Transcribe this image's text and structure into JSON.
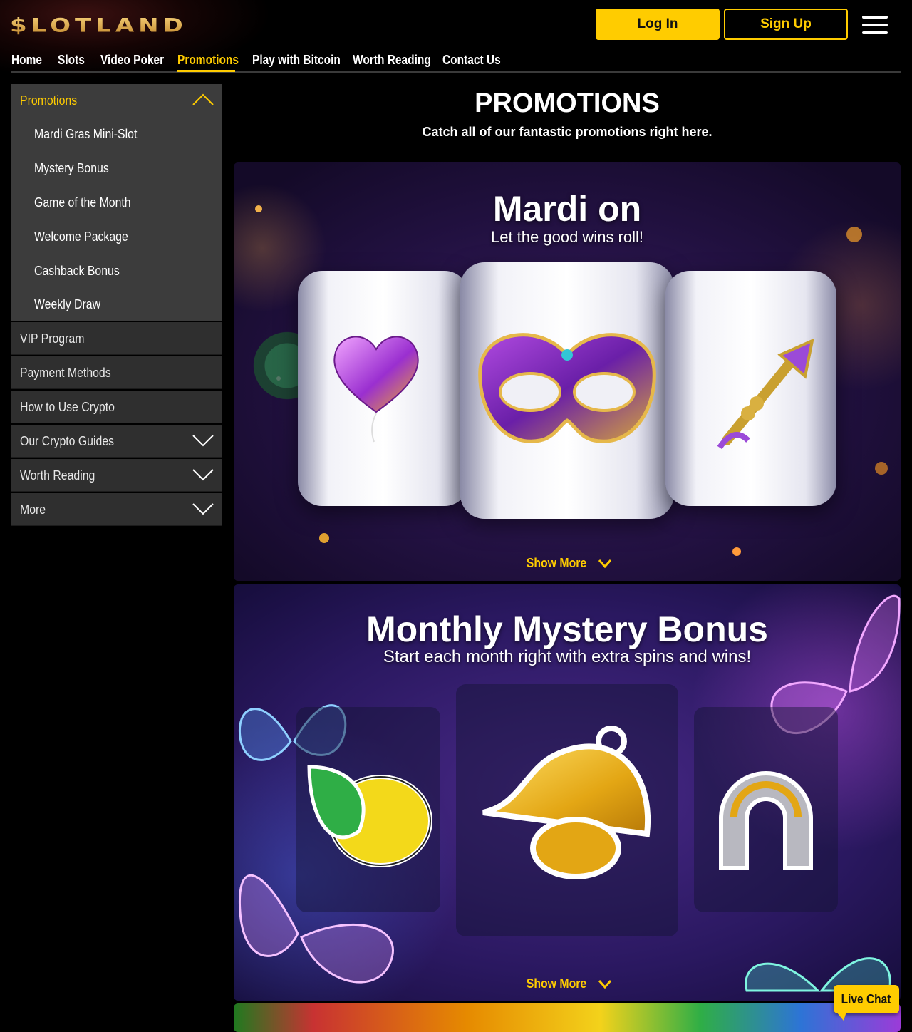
{
  "header": {
    "logo_text": "$LOTLAND",
    "login_label": "Log In",
    "signup_label": "Sign Up",
    "menu_icon": "hamburger-icon"
  },
  "nav": {
    "items": [
      "Home",
      "Slots",
      "Video Poker",
      "Promotions",
      "Play with Bitcoin",
      "Worth Reading",
      "Contact Us"
    ],
    "active": "Promotions"
  },
  "sidebar": {
    "group": {
      "label": "Promotions",
      "expanded": true,
      "items": [
        "Mardi Gras Mini-Slot",
        "Mystery Bonus",
        "Game of the Month",
        "Welcome Package",
        "Cashback Bonus",
        "Weekly Draw"
      ]
    },
    "items": [
      {
        "label": "VIP Program",
        "has_chevron": false
      },
      {
        "label": "Payment Methods",
        "has_chevron": false
      },
      {
        "label": "How to Use Crypto",
        "has_chevron": false
      },
      {
        "label": "Our Crypto Guides",
        "has_chevron": true
      },
      {
        "label": "Worth Reading",
        "has_chevron": true
      },
      {
        "label": "More",
        "has_chevron": true
      }
    ]
  },
  "main": {
    "title": "PROMOTIONS",
    "subtitle": "Catch all of our fantastic promotions right here."
  },
  "promos": [
    {
      "title": "Mardi on",
      "subtitle": "Let the good wins roll!",
      "show_more": "Show More",
      "symbols": [
        "heart-balloon-icon",
        "mardi-gras-mask-icon",
        "trumpet-icon"
      ]
    },
    {
      "title": "Monthly Mystery Bonus",
      "subtitle": "Start each month right with extra spins and wins!",
      "show_more": "Show More",
      "symbols": [
        "lemon-icon",
        "bell-icon",
        "horseshoe-icon"
      ]
    }
  ],
  "live_chat": {
    "label": "Live Chat"
  },
  "colors": {
    "accent": "#ffcc00",
    "sidebar_bg": "#3c3c3c",
    "background": "#000000"
  }
}
